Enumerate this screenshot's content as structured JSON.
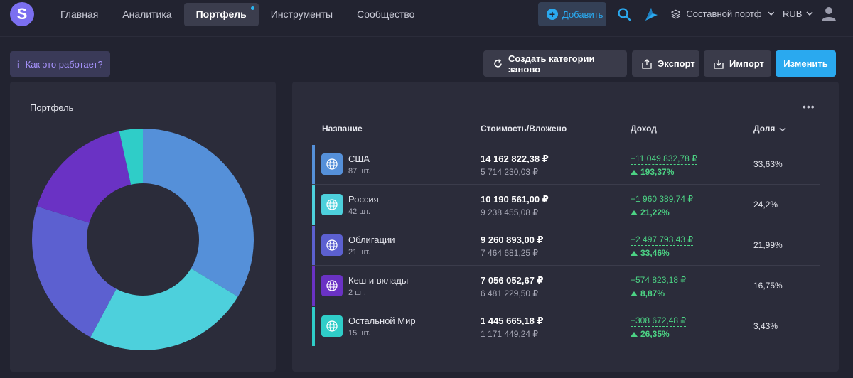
{
  "app": {
    "logo_letter": "S"
  },
  "nav": {
    "items": [
      {
        "label": "Главная",
        "active": false
      },
      {
        "label": "Аналитика",
        "active": false
      },
      {
        "label": "Портфель",
        "active": true
      },
      {
        "label": "Инструменты",
        "active": false
      },
      {
        "label": "Сообщество",
        "active": false
      }
    ],
    "add_label": "Добавить",
    "portfolio_select": "Составной портфель",
    "currency": "RUB"
  },
  "toolbar": {
    "how_label": "Как это работает?",
    "recreate_label": "Создать категории заново",
    "export_label": "Экспорт",
    "import_label": "Импорт",
    "edit_label": "Изменить"
  },
  "left_panel": {
    "title": "Портфель"
  },
  "table": {
    "headers": {
      "name": "Название",
      "value": "Стоимость/Вложено",
      "income": "Доход",
      "share": "Доля"
    },
    "rows": [
      {
        "name": "США",
        "qty": "87 шт.",
        "value": "14 162 822,38 ₽",
        "invested": "5 714 230,03 ₽",
        "income": "+11 049 832,78 ₽",
        "income_pct": "193,37%",
        "share": "33,63%",
        "color": "#5590d9"
      },
      {
        "name": "Россия",
        "qty": "42 шт.",
        "value": "10 190 561,00 ₽",
        "invested": "9 238 455,08 ₽",
        "income": "+1 960 389,74 ₽",
        "income_pct": "21,22%",
        "share": "24,2%",
        "color": "#4dd0dc"
      },
      {
        "name": "Облигации",
        "qty": "21 шт.",
        "value": "9 260 893,00 ₽",
        "invested": "7 464 681,25 ₽",
        "income": "+2 497 793,43 ₽",
        "income_pct": "33,46%",
        "share": "21,99%",
        "color": "#5c60d0"
      },
      {
        "name": "Кеш и вклады",
        "qty": "2 шт.",
        "value": "7 056 052,67 ₽",
        "invested": "6 481 229,50 ₽",
        "income": "+574 823,18 ₽",
        "income_pct": "8,87%",
        "share": "16,75%",
        "color": "#6a32c4"
      },
      {
        "name": "Остальной Мир",
        "qty": "15 шт.",
        "value": "1 445 665,18 ₽",
        "invested": "1 171 449,24 ₽",
        "income": "+308 672,48 ₽",
        "income_pct": "26,35%",
        "share": "3,43%",
        "color": "#2fcdc8"
      }
    ]
  },
  "chart_data": {
    "type": "pie",
    "title": "Портфель",
    "categories": [
      "США",
      "Россия",
      "Облигации",
      "Кеш и вклады",
      "Остальной Мир"
    ],
    "values": [
      33.63,
      24.2,
      21.99,
      16.75,
      3.43
    ],
    "colors": [
      "#5590d9",
      "#4dd0dc",
      "#5c60d0",
      "#6a32c4",
      "#2fcdc8"
    ]
  }
}
